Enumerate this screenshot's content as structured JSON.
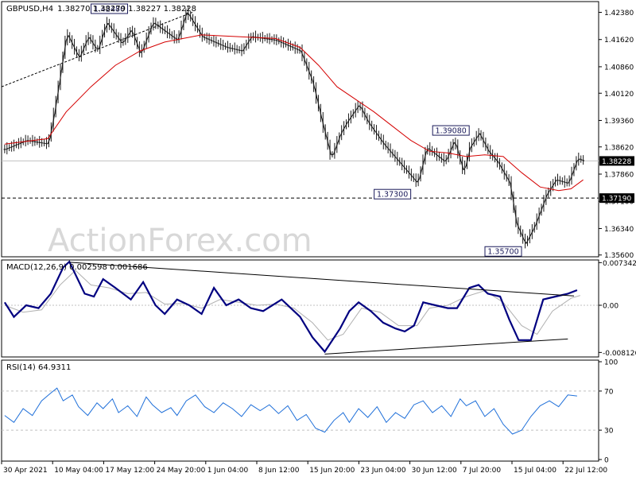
{
  "symbol_header": {
    "symbol": "GBPUSD,H4",
    "ohlc": "1.38270 1.38279 1.38227 1.38228"
  },
  "watermark": "ActionForex.com",
  "colors": {
    "candle": "#1a1a1a",
    "ma": "#d40000",
    "macd": "#000080",
    "signal": "#b0b0b0",
    "rsi": "#1e6fd9",
    "grid": "#c0c0c0",
    "axis_text": "#000000",
    "label_border": "#1a1a5a"
  },
  "chart_data": [
    {
      "type": "candlestick",
      "title": "GBPUSD,H4",
      "ylim": [
        1.3555,
        1.4268
      ],
      "yticks": [
        "1.42380",
        "1.41620",
        "1.40860",
        "1.40120",
        "1.39360",
        "1.38620",
        "1.37860",
        "1.37100",
        "1.36340",
        "1.35600"
      ],
      "price_label_current": "1.38228",
      "price_label_support": "1.37190",
      "annotations": [
        {
          "text": "1.42480",
          "x": 1.7,
          "value": 1.4248
        },
        {
          "text": "1.39080",
          "x": 7.25,
          "value": 1.3908
        },
        {
          "text": "1.37300",
          "x": 6.3,
          "value": 1.373
        },
        {
          "text": "1.35700",
          "x": 8.1,
          "value": 1.357
        }
      ],
      "support_line": 1.3719,
      "trendline": [
        [
          -0.05,
          1.403
        ],
        [
          3.05,
          1.4238
        ]
      ],
      "path": [
        [
          0.0,
          1.3855
        ],
        [
          0.35,
          1.388
        ],
        [
          0.7,
          1.387
        ],
        [
          0.8,
          1.396
        ],
        [
          1.0,
          1.418
        ],
        [
          1.2,
          1.411
        ],
        [
          1.35,
          1.417
        ],
        [
          1.5,
          1.413
        ],
        [
          1.65,
          1.421
        ],
        [
          1.9,
          1.415
        ],
        [
          2.05,
          1.419
        ],
        [
          2.2,
          1.412
        ],
        [
          2.4,
          1.421
        ],
        [
          2.8,
          1.416
        ],
        [
          2.95,
          1.424
        ],
        [
          3.2,
          1.417
        ],
        [
          3.6,
          1.414
        ],
        [
          3.85,
          1.413
        ],
        [
          4.0,
          1.417
        ],
        [
          4.4,
          1.416
        ],
        [
          4.8,
          1.413
        ],
        [
          5.0,
          1.404
        ],
        [
          5.15,
          1.393
        ],
        [
          5.3,
          1.383
        ],
        [
          5.45,
          1.39
        ],
        [
          5.55,
          1.393
        ],
        [
          5.75,
          1.398
        ],
        [
          5.9,
          1.393
        ],
        [
          6.15,
          1.387
        ],
        [
          6.45,
          1.381
        ],
        [
          6.7,
          1.376
        ],
        [
          6.85,
          1.386
        ],
        [
          7.0,
          1.384
        ],
        [
          7.15,
          1.382
        ],
        [
          7.3,
          1.388
        ],
        [
          7.45,
          1.379
        ],
        [
          7.55,
          1.386
        ],
        [
          7.7,
          1.39
        ],
        [
          7.85,
          1.385
        ],
        [
          8.0,
          1.382
        ],
        [
          8.2,
          1.376
        ],
        [
          8.3,
          1.365
        ],
        [
          8.45,
          1.359
        ],
        [
          8.6,
          1.364
        ],
        [
          8.8,
          1.373
        ],
        [
          8.95,
          1.377
        ],
        [
          9.15,
          1.376
        ],
        [
          9.3,
          1.383
        ],
        [
          9.4,
          1.3823
        ]
      ],
      "ma_path": [
        [
          0.0,
          1.387
        ],
        [
          0.7,
          1.3885
        ],
        [
          1.0,
          1.396
        ],
        [
          1.4,
          1.403
        ],
        [
          1.8,
          1.409
        ],
        [
          2.2,
          1.413
        ],
        [
          2.6,
          1.4155
        ],
        [
          3.2,
          1.4175
        ],
        [
          3.8,
          1.417
        ],
        [
          4.4,
          1.4165
        ],
        [
          4.8,
          1.414
        ],
        [
          5.1,
          1.409
        ],
        [
          5.4,
          1.403
        ],
        [
          5.7,
          1.3995
        ],
        [
          6.0,
          1.396
        ],
        [
          6.3,
          1.392
        ],
        [
          6.6,
          1.388
        ],
        [
          6.9,
          1.385
        ],
        [
          7.2,
          1.3845
        ],
        [
          7.5,
          1.3835
        ],
        [
          7.8,
          1.384
        ],
        [
          8.1,
          1.3835
        ],
        [
          8.4,
          1.379
        ],
        [
          8.7,
          1.375
        ],
        [
          9.0,
          1.374
        ],
        [
          9.2,
          1.3745
        ],
        [
          9.4,
          1.377
        ]
      ],
      "x_axis": {
        "range": [
          -0.05,
          9.65
        ],
        "labels": [
          {
            "text": "30 Apr 2021",
            "x": 0.0
          },
          {
            "text": "10 May 04:00",
            "x": 1.0
          },
          {
            "text": "17 May 12:00",
            "x": 2.0
          },
          {
            "text": "24 May 20:00",
            "x": 3.0
          },
          {
            "text": "1 Jun 04:00",
            "x": 4.0
          },
          {
            "text": "8 Jun 12:00",
            "x": 5.0
          },
          {
            "text": "15 Jun 20:00",
            "x": 6.0
          },
          {
            "text": "23 Jun 04:00",
            "x": 7.0
          },
          {
            "text": "30 Jun 12:00",
            "x": 8.0
          },
          {
            "text": "7 Jul 20:00",
            "x": 9.0
          },
          {
            "text": "15 Jul 04:00",
            "x": 10.0
          },
          {
            "text": "22 Jul 12:00",
            "x": 11.0
          }
        ]
      }
    },
    {
      "type": "line",
      "title": "MACD(12,26,9) 0.002598 0.001686",
      "ylim": [
        -0.0089,
        0.0078
      ],
      "yticks": [
        "0.007342",
        "0.00",
        "-0.008126"
      ],
      "zero_label": "0.00",
      "series": [
        {
          "values": [
            [
              0.0,
              0.0005
            ],
            [
              0.15,
              -0.002
            ],
            [
              0.35,
              0.0
            ],
            [
              0.55,
              -0.0005
            ],
            [
              0.75,
              0.002
            ],
            [
              0.95,
              0.0065
            ],
            [
              1.05,
              0.0075
            ],
            [
              1.3,
              0.002
            ],
            [
              1.45,
              0.0015
            ],
            [
              1.6,
              0.0045
            ],
            [
              1.8,
              0.003
            ],
            [
              2.05,
              0.001
            ],
            [
              2.25,
              0.004
            ],
            [
              2.45,
              0.0
            ],
            [
              2.6,
              -0.0015
            ],
            [
              2.8,
              0.001
            ],
            [
              3.0,
              0.0
            ],
            [
              3.2,
              -0.0015
            ],
            [
              3.4,
              0.003
            ],
            [
              3.6,
              0.0
            ],
            [
              3.8,
              0.001
            ],
            [
              4.0,
              -0.0005
            ],
            [
              4.2,
              -0.001
            ],
            [
              4.5,
              0.001
            ],
            [
              4.8,
              -0.002
            ],
            [
              5.0,
              -0.0055
            ],
            [
              5.2,
              -0.008
            ],
            [
              5.45,
              -0.004
            ],
            [
              5.6,
              -0.001
            ],
            [
              5.75,
              0.0005
            ],
            [
              5.95,
              -0.001
            ],
            [
              6.15,
              -0.003
            ],
            [
              6.35,
              -0.004
            ],
            [
              6.5,
              -0.0045
            ],
            [
              6.65,
              -0.0035
            ],
            [
              6.8,
              0.0005
            ],
            [
              7.0,
              0.0
            ],
            [
              7.2,
              -0.0005
            ],
            [
              7.35,
              -0.0005
            ],
            [
              7.55,
              0.003
            ],
            [
              7.7,
              0.0035
            ],
            [
              7.85,
              0.002
            ],
            [
              8.05,
              0.0015
            ],
            [
              8.2,
              -0.0025
            ],
            [
              8.35,
              -0.006
            ],
            [
              8.55,
              -0.006
            ],
            [
              8.75,
              0.001
            ],
            [
              8.95,
              0.0015
            ],
            [
              9.15,
              0.002
            ],
            [
              9.3,
              0.0026
            ]
          ]
        },
        {
          "values": [
            [
              0.0,
              0.0
            ],
            [
              0.3,
              -0.0012
            ],
            [
              0.6,
              -0.0008
            ],
            [
              0.9,
              0.0035
            ],
            [
              1.15,
              0.006
            ],
            [
              1.4,
              0.0035
            ],
            [
              1.7,
              0.003
            ],
            [
              2.0,
              0.002
            ],
            [
              2.3,
              0.0022
            ],
            [
              2.6,
              0.0002
            ],
            [
              2.9,
              0.0003
            ],
            [
              3.2,
              -0.0005
            ],
            [
              3.5,
              0.001
            ],
            [
              3.8,
              0.0005
            ],
            [
              4.1,
              0.0
            ],
            [
              4.4,
              0.0002
            ],
            [
              4.7,
              -0.0005
            ],
            [
              5.0,
              -0.003
            ],
            [
              5.25,
              -0.006
            ],
            [
              5.5,
              -0.005
            ],
            [
              5.8,
              -0.0005
            ],
            [
              6.1,
              -0.0012
            ],
            [
              6.4,
              -0.0035
            ],
            [
              6.7,
              -0.0035
            ],
            [
              6.9,
              -0.0005
            ],
            [
              7.2,
              0.0
            ],
            [
              7.5,
              0.0015
            ],
            [
              7.8,
              0.0025
            ],
            [
              8.1,
              0.0005
            ],
            [
              8.4,
              -0.0035
            ],
            [
              8.65,
              -0.005
            ],
            [
              8.9,
              -0.001
            ],
            [
              9.2,
              0.0012
            ],
            [
              9.35,
              0.0017
            ]
          ]
        }
      ],
      "trendlines": [
        [
          [
            1.05,
            0.0074
          ],
          [
            9.25,
            0.0016
          ]
        ],
        [
          [
            5.2,
            -0.0084
          ],
          [
            9.15,
            -0.0058
          ]
        ]
      ]
    },
    {
      "type": "line",
      "title": "RSI(14) 64.9311",
      "ylim": [
        0,
        100
      ],
      "yticks": [
        "100",
        "70",
        "30",
        "0"
      ],
      "levels": [
        70,
        30
      ],
      "series": [
        {
          "values": [
            [
              0.0,
              45
            ],
            [
              0.15,
              38
            ],
            [
              0.3,
              52
            ],
            [
              0.45,
              45
            ],
            [
              0.6,
              60
            ],
            [
              0.75,
              68
            ],
            [
              0.85,
              73
            ],
            [
              0.95,
              60
            ],
            [
              1.1,
              66
            ],
            [
              1.2,
              54
            ],
            [
              1.35,
              45
            ],
            [
              1.5,
              58
            ],
            [
              1.6,
              52
            ],
            [
              1.75,
              62
            ],
            [
              1.85,
              48
            ],
            [
              2.0,
              55
            ],
            [
              2.15,
              44
            ],
            [
              2.3,
              64
            ],
            [
              2.4,
              56
            ],
            [
              2.55,
              48
            ],
            [
              2.7,
              53
            ],
            [
              2.8,
              45
            ],
            [
              2.95,
              60
            ],
            [
              3.1,
              66
            ],
            [
              3.25,
              54
            ],
            [
              3.4,
              48
            ],
            [
              3.55,
              58
            ],
            [
              3.7,
              52
            ],
            [
              3.85,
              44
            ],
            [
              4.0,
              56
            ],
            [
              4.15,
              50
            ],
            [
              4.3,
              56
            ],
            [
              4.45,
              47
            ],
            [
              4.6,
              55
            ],
            [
              4.75,
              40
            ],
            [
              4.9,
              46
            ],
            [
              5.05,
              32
            ],
            [
              5.2,
              28
            ],
            [
              5.35,
              40
            ],
            [
              5.5,
              48
            ],
            [
              5.6,
              38
            ],
            [
              5.75,
              52
            ],
            [
              5.9,
              43
            ],
            [
              6.05,
              54
            ],
            [
              6.2,
              38
            ],
            [
              6.35,
              48
            ],
            [
              6.5,
              42
            ],
            [
              6.65,
              56
            ],
            [
              6.8,
              60
            ],
            [
              6.95,
              48
            ],
            [
              7.1,
              55
            ],
            [
              7.25,
              44
            ],
            [
              7.4,
              62
            ],
            [
              7.5,
              55
            ],
            [
              7.65,
              60
            ],
            [
              7.8,
              44
            ],
            [
              7.95,
              52
            ],
            [
              8.1,
              36
            ],
            [
              8.25,
              26
            ],
            [
              8.4,
              30
            ],
            [
              8.55,
              44
            ],
            [
              8.7,
              55
            ],
            [
              8.85,
              60
            ],
            [
              9.0,
              54
            ],
            [
              9.15,
              66
            ],
            [
              9.3,
              65
            ]
          ]
        }
      ]
    }
  ]
}
